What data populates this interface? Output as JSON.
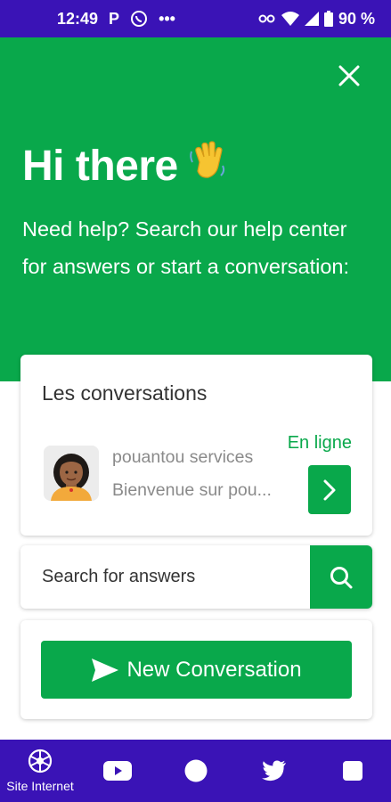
{
  "status_bar": {
    "time": "12:49",
    "carrier_letter": "P",
    "more": "•••",
    "battery": "90 %"
  },
  "hero": {
    "title": "Hi there",
    "subtitle": "Need help? Search our help center for answers or start a conversation:",
    "icons": [
      "close-icon",
      "waving-hand-icon"
    ]
  },
  "conversations": {
    "title": "Les conversations",
    "item": {
      "name": "pouantou services",
      "preview": "Bienvenue sur pou...",
      "status": "En ligne"
    }
  },
  "search": {
    "placeholder": "Search for answers"
  },
  "new_conversation": {
    "label": "New Conversation"
  },
  "bottom_nav": {
    "items": [
      {
        "icon": "globe-icon",
        "label": "Site Internet"
      },
      {
        "icon": "youtube-icon",
        "label": ""
      },
      {
        "icon": "circle-icon",
        "label": ""
      },
      {
        "icon": "twitter-icon",
        "label": ""
      },
      {
        "icon": "square-icon",
        "label": ""
      }
    ]
  },
  "colors": {
    "primary_green": "#09a84b",
    "nav_purple": "#3a13b6"
  }
}
